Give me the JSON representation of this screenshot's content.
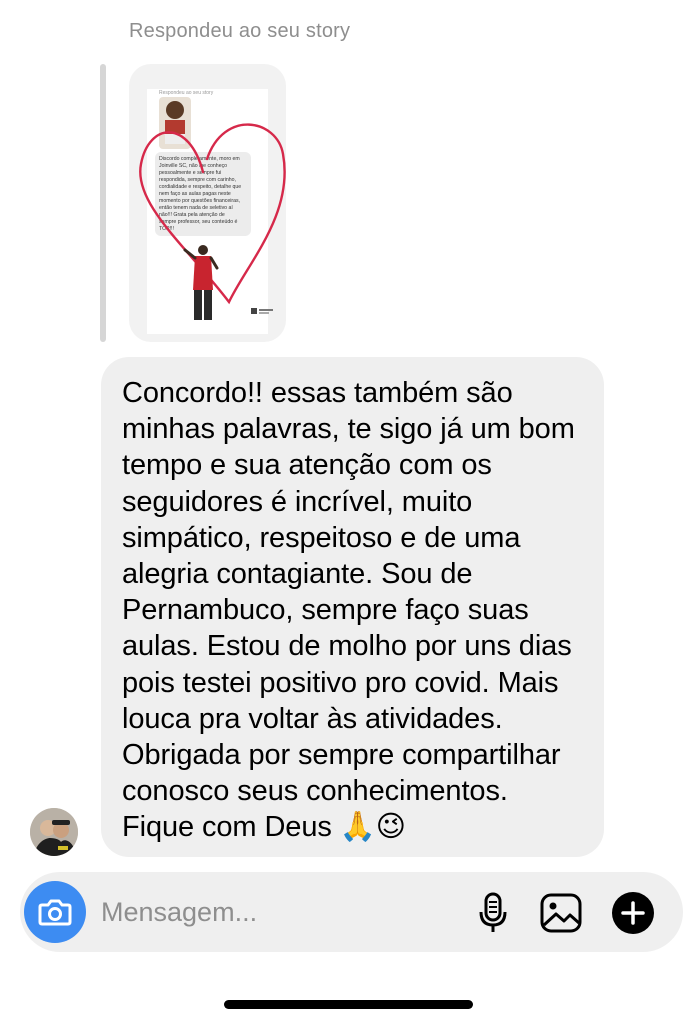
{
  "thread": {
    "reply_caption": "Respondeu ao seu story",
    "story_thumbnail": {
      "header": "Respondeu ao seu story",
      "body_lines": [
        "Discordo completamente, moro em",
        "Joinville SC, não lhe conheço",
        "pessoalmente e sempre fui",
        "respondida, sempre com carinho,",
        "cordialidade e respeito, detalhe que",
        "nem faço as aulas pagas neste",
        "momento por questões financeiras,",
        "então tenem nada de seletivo aí",
        "não!!! Grata pela atenção de",
        "sempre professor, seu conteúdo é",
        "TOP!!!"
      ],
      "heart_color": "#d6294a"
    },
    "message": {
      "text": "Concordo!! essas também são\nminhas palavras, te sigo já um bom\ntempo e sua atenção com os\nseguidores é incrível, muito\nsimpático, respeitoso e de uma\nalegria contagiante. Sou de\nPernambuco, sempre faço suas\naulas. Estou de molho por uns dias\npois testei positivo pro covid. Mais\nlouca pra voltar às atividades.\nObrigada por sempre compartilhar\nconosco seus conhecimentos.\nFique com Deus 🙏😉"
    }
  },
  "composer": {
    "placeholder": "Mensagem...",
    "camera_icon": "camera-icon",
    "mic_icon": "microphone-icon",
    "gallery_icon": "image-gallery-icon",
    "plus_icon": "plus-circle-icon",
    "accent_color": "#3d8cf2"
  },
  "colors": {
    "bubble_bg": "#efefef",
    "caption": "#8e8e8e"
  }
}
